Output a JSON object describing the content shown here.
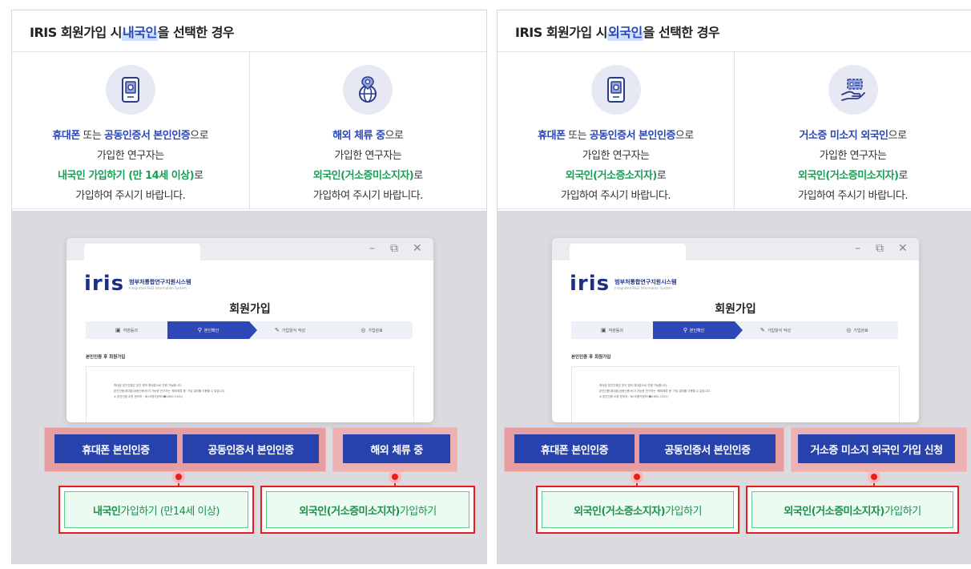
{
  "left": {
    "title_pre": "IRIS 회원가입 시 ",
    "title_hl": "내국인",
    "title_post": "을 선택한 경우",
    "col1": {
      "icon": "phone-certificate-icon",
      "line1_a": "휴대폰",
      "line1_b": " 또는 ",
      "line1_c": "공동인증서 본인인증",
      "line1_d": "으로",
      "line2": "가입한 연구자는",
      "line3_a": "내국인 가입하기 (만 14세 이상)",
      "line3_b": "로",
      "line4": "가입하여 주시기 바랍니다."
    },
    "col2": {
      "icon": "globe-pin-icon",
      "line1_a": "해외 체류 중",
      "line1_b": "으로",
      "line2": "가입한 연구자는",
      "line3_a": "외국인(거소증미소지자)",
      "line3_b": "로",
      "line4": "가입하여 주시기 바랍니다."
    },
    "buttons": [
      "휴대폰 본인인증",
      "공동인증서 본인인증",
      "해외 체류 중"
    ],
    "out1_a": "내국인",
    "out1_b": " 가입하기 (만14세 이상)",
    "out2_a": "외국인(거소증미소지자)",
    "out2_b": " 가입하기"
  },
  "right": {
    "title_pre": "IRIS 회원가입 시 ",
    "title_hl": "외국인",
    "title_post": "을 선택한 경우",
    "col1": {
      "icon": "phone-certificate-icon",
      "line1_a": "휴대폰",
      "line1_b": " 또는 ",
      "line1_c": "공동인증서 본인인증",
      "line1_d": "으로",
      "line2": "가입한 연구자는",
      "line3_a": "외국인(거소증소지자)",
      "line3_b": "로",
      "line4": "가입하여 주시기 바랍니다."
    },
    "col2": {
      "icon": "id-card-hand-icon",
      "line1_a": "거소증 미소지 외국인",
      "line1_b": "으로",
      "line2": "가입한 연구자는",
      "line3_a": "외국인(거소증미소지자)",
      "line3_b": "로",
      "line4": "가입하여 주시기 바랍니다."
    },
    "buttons": [
      "휴대폰 본인인증",
      "공동인증서 본인인증",
      "거소증 미소지 외국인 가입 신청"
    ],
    "out1_a": "외국인(거소증소지자)",
    "out1_b": " 가입하기",
    "out2_a": "외국인(거소증미소지자)",
    "out2_b": " 가입하기"
  },
  "mock": {
    "logo": "iris",
    "brand_ko": "범부처통합연구지원시스템",
    "brand_en": "Integrated R&D Information System",
    "heading": "회원가입",
    "steps": [
      "약관동의",
      "본인확인",
      "가입양식 작성",
      "가입완료"
    ],
    "sub_head": "본인인증 후 회원가입",
    "fine1": "휴대폰 본인인증은 본인 명의 휴대폰으로 진행 가능합니다.",
    "fine2": "본인인증(휴대폰/공동인증서)이 가능한 연구자는 '해외체류 중' 가입 절차를 이용할 수 없습니다.",
    "fine3": "※ 본인인증 오류 문의처 : NICE평가정보(☎1600-1522)",
    "ctrl_min": "–",
    "ctrl_restore": "⧉",
    "ctrl_close": "✕"
  }
}
